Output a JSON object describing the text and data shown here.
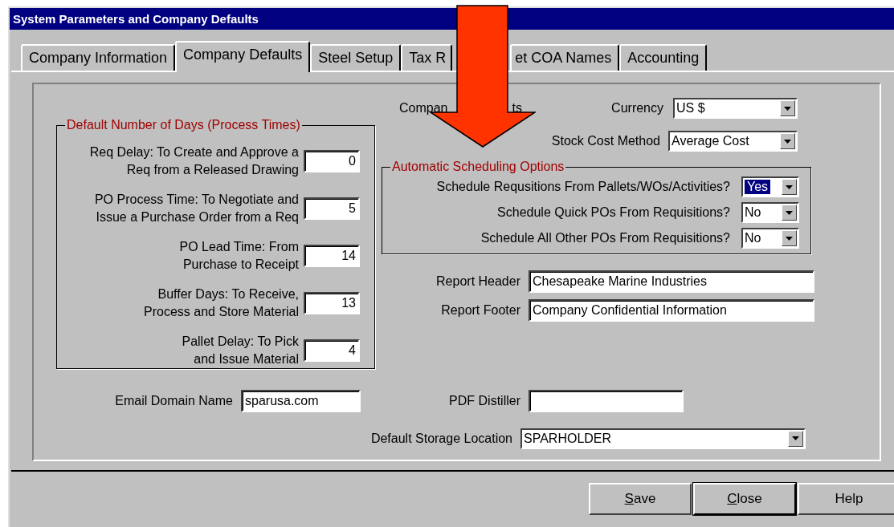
{
  "window": {
    "title": "System Parameters and Company Defaults"
  },
  "tabs": [
    {
      "label": "Company Information",
      "selected": false
    },
    {
      "label": "Company Defaults",
      "selected": true
    },
    {
      "label": "Steel Setup",
      "selected": false
    },
    {
      "label": "Tax R",
      "selected": false
    },
    {
      "label": "et COA Names",
      "selected": false
    },
    {
      "label": "Accounting",
      "selected": false
    }
  ],
  "company_defaults_label": {
    "parts": [
      "Compan",
      "ts"
    ]
  },
  "currency": {
    "label": "Currency",
    "value": "US $"
  },
  "stock_cost_method": {
    "label": "Stock Cost Method",
    "value": "Average Cost"
  },
  "process_times": {
    "title": "Default Number of Days (Process Times)",
    "rows": [
      {
        "label_lines": [
          "Req Delay: To Create and Approve a",
          "Req from a Released Drawing"
        ],
        "value": "0"
      },
      {
        "label_lines": [
          "PO Process Time: To Negotiate and",
          "Issue a Purchase Order from a Req"
        ],
        "value": "5"
      },
      {
        "label_lines": [
          "PO Lead Time:  From",
          "Purchase to Receipt"
        ],
        "value": "14"
      },
      {
        "label_lines": [
          "Buffer Days: To Receive,",
          "Process and Store Material"
        ],
        "value": "13"
      },
      {
        "label_lines": [
          "Pallet Delay: To Pick",
          "and Issue Material"
        ],
        "value": "4"
      }
    ]
  },
  "automatic_scheduling": {
    "title": "Automatic Scheduling Options",
    "options": [
      {
        "label": "Schedule Requsitions From Pallets/WOs/Activities?",
        "value": "Yes",
        "focused": true
      },
      {
        "label": "Schedule Quick POs From Requisitions?",
        "value": "No",
        "focused": false
      },
      {
        "label": "Schedule All Other POs From Requisitions?",
        "value": "No",
        "focused": false
      }
    ]
  },
  "report_header": {
    "label": "Report Header",
    "value": "Chesapeake Marine Industries"
  },
  "report_footer": {
    "label": "Report Footer",
    "value": "Company Confidential Information"
  },
  "email_domain": {
    "label": "Email Domain Name",
    "value": "sparusa.com"
  },
  "pdf_distiller": {
    "label": "PDF Distiller"
  },
  "default_storage_location": {
    "label": "Default Storage Location",
    "value": "SPARHOLDER"
  },
  "buttons": [
    {
      "label": "Save",
      "mnemonic": true,
      "default": false
    },
    {
      "label": "Close",
      "mnemonic": true,
      "default": true
    },
    {
      "label": "Help",
      "mnemonic": false,
      "default": false
    }
  ],
  "overlay": {
    "kind": "arrow"
  }
}
